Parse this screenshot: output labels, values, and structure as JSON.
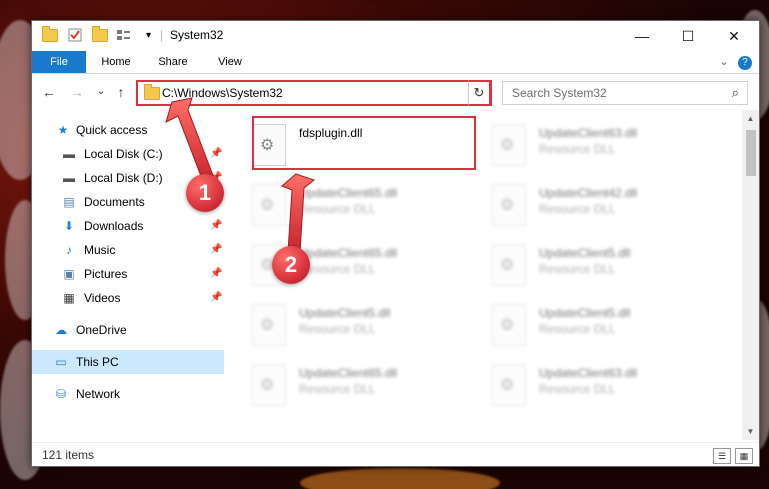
{
  "window": {
    "title": "System32",
    "controls": {
      "minimize": "—",
      "maximize": "☐",
      "close": "✕"
    },
    "qa_dropdown": "▾"
  },
  "ribbon": {
    "tabs": [
      {
        "label": "File"
      },
      {
        "label": "Home"
      },
      {
        "label": "Share"
      },
      {
        "label": "View"
      }
    ],
    "help_icon": "?",
    "collapse_icon": "⌄"
  },
  "nav": {
    "back": "←",
    "forward": "→",
    "recent": "⌄",
    "up": "↑",
    "address": "C:\\Windows\\System32",
    "address_chevron": "⌄",
    "refresh": "↻",
    "search_placeholder": "Search System32",
    "search_icon": "⌕"
  },
  "sidebar": {
    "items": [
      {
        "label": "Quick access",
        "icon": "★",
        "pinned": false
      },
      {
        "label": "Local Disk (C:)",
        "icon": "▬",
        "pinned": true
      },
      {
        "label": "Local Disk (D:)",
        "icon": "▬",
        "pinned": true
      },
      {
        "label": "Documents",
        "icon": "▤",
        "pinned": true
      },
      {
        "label": "Downloads",
        "icon": "⬇",
        "pinned": true
      },
      {
        "label": "Music",
        "icon": "♪",
        "pinned": true
      },
      {
        "label": "Pictures",
        "icon": "▣",
        "pinned": true
      },
      {
        "label": "Videos",
        "icon": "▦",
        "pinned": true
      },
      {
        "label": "OneDrive",
        "icon": "☁",
        "pinned": false
      },
      {
        "label": "This PC",
        "icon": "▭",
        "pinned": false
      },
      {
        "label": "Network",
        "icon": "⛁",
        "pinned": false
      }
    ],
    "pin_glyph": "📌"
  },
  "files": [
    {
      "name": "fdsplugin.dll",
      "type": "",
      "highlighted": true
    },
    {
      "name": "UpdateClient63.dll",
      "type": "Resource DLL"
    },
    {
      "name": "UpdateClient65.dll",
      "type": "Resource DLL"
    },
    {
      "name": "UpdateClient42.dll",
      "type": "Resource DLL"
    },
    {
      "name": "UpdateClient65.dll",
      "type": "Resource DLL"
    },
    {
      "name": "UpdateClient5.dll",
      "type": "Resource DLL"
    },
    {
      "name": "UpdateClient5.dll",
      "type": "Resource DLL"
    },
    {
      "name": "UpdateClient5.dll",
      "type": "Resource DLL"
    },
    {
      "name": "UpdateClient65.dll",
      "type": "Resource DLL"
    },
    {
      "name": "UpdateClient63.dll",
      "type": "Resource DLL"
    }
  ],
  "scrollbar": {
    "up": "▲",
    "down": "▼"
  },
  "status": {
    "item_count": "121 items",
    "details_view_icon": "☰",
    "tiles_view_icon": "▦"
  },
  "annotations": {
    "step1": "1",
    "step2": "2",
    "color": "#d9333f"
  }
}
